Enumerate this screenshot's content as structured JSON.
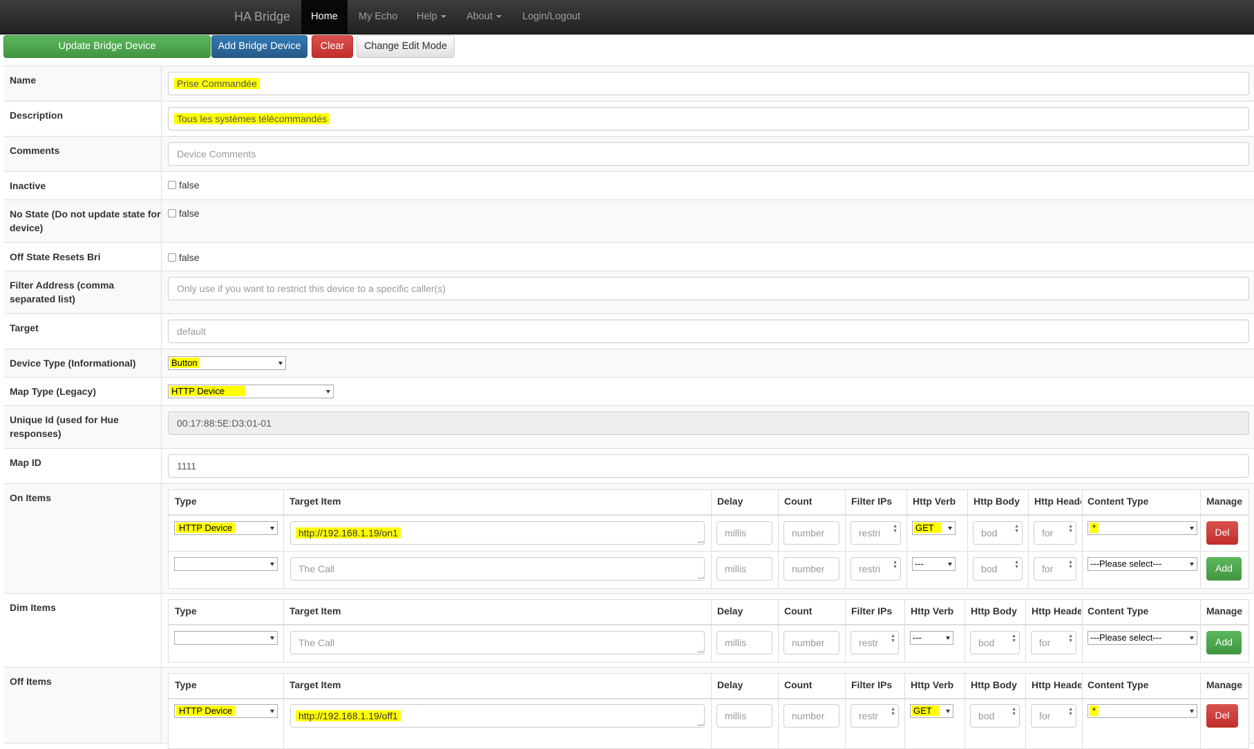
{
  "navbar": {
    "brand": "HA Bridge",
    "items": [
      {
        "label": "Home"
      },
      {
        "label": "My Echo"
      },
      {
        "label": "Help"
      },
      {
        "label": "About"
      },
      {
        "label": "Login/Logout"
      }
    ]
  },
  "toolbar": {
    "update_label": "Update Bridge Device",
    "add_label": "Add Bridge Device",
    "clear_label": "Clear",
    "edit_mode_label": "Change Edit Mode"
  },
  "form": {
    "name": {
      "label": "Name",
      "value": "Prise Commandée"
    },
    "description": {
      "label": "Description",
      "value": "Tous les systèmes télécommandés"
    },
    "comments": {
      "label": "Comments",
      "placeholder": "Device Comments"
    },
    "inactive": {
      "label": "Inactive",
      "value": "false"
    },
    "no_state": {
      "label": "No State (Do not update state for device)",
      "value": "false"
    },
    "off_state": {
      "label": "Off State Resets Bri",
      "value": "false"
    },
    "filter_address": {
      "label": "Filter Address (comma separated list)",
      "placeholder": "Only use if you want to restrict this device to a specific caller(s)"
    },
    "target": {
      "label": "Target",
      "placeholder": "default"
    },
    "device_type": {
      "label": "Device Type (Informational)",
      "value": "Button"
    },
    "map_type": {
      "label": "Map Type (Legacy)",
      "value": "HTTP Device"
    },
    "unique_id": {
      "label": "Unique Id (used for Hue responses)",
      "value": "00:17:88:5E:D3:01-01"
    },
    "map_id": {
      "label": "Map ID",
      "value": "1111"
    }
  },
  "items_headers": {
    "type": "Type",
    "target": "Target Item",
    "delay": "Delay",
    "count": "Count",
    "filter_ips": "Filter IPs",
    "http_verb": "Http Verb",
    "http_body": "Http Body",
    "http_headers": "Http Headers",
    "content_type": "Content Type",
    "manage": "Manage"
  },
  "placeholders": {
    "target": "The Call",
    "delay": "millis",
    "count": "number",
    "filter": "restri",
    "filter_short": "restr",
    "body": "bod",
    "headers": "for",
    "verb_none": "---",
    "content_none": "---Please select---"
  },
  "on_items": {
    "label": "On Items",
    "row1": {
      "type": "HTTP Device",
      "target": "http://192.168.1.19/on1",
      "verb": "GET",
      "content": "*",
      "action": "Del"
    },
    "row2": {
      "action": "Add"
    }
  },
  "dim_items": {
    "label": "Dim Items",
    "row1": {
      "action": "Add"
    }
  },
  "off_items": {
    "label": "Off Items",
    "row1": {
      "type": "HTTP Device",
      "target": "http://192.168.1.19/off1",
      "verb": "GET",
      "content": "*",
      "action": "Del"
    }
  },
  "colors": {
    "highlight": "#ffff00",
    "success": "#5cb85c",
    "primary": "#337ab7",
    "danger": "#d9534f",
    "navbar": "#222222"
  }
}
